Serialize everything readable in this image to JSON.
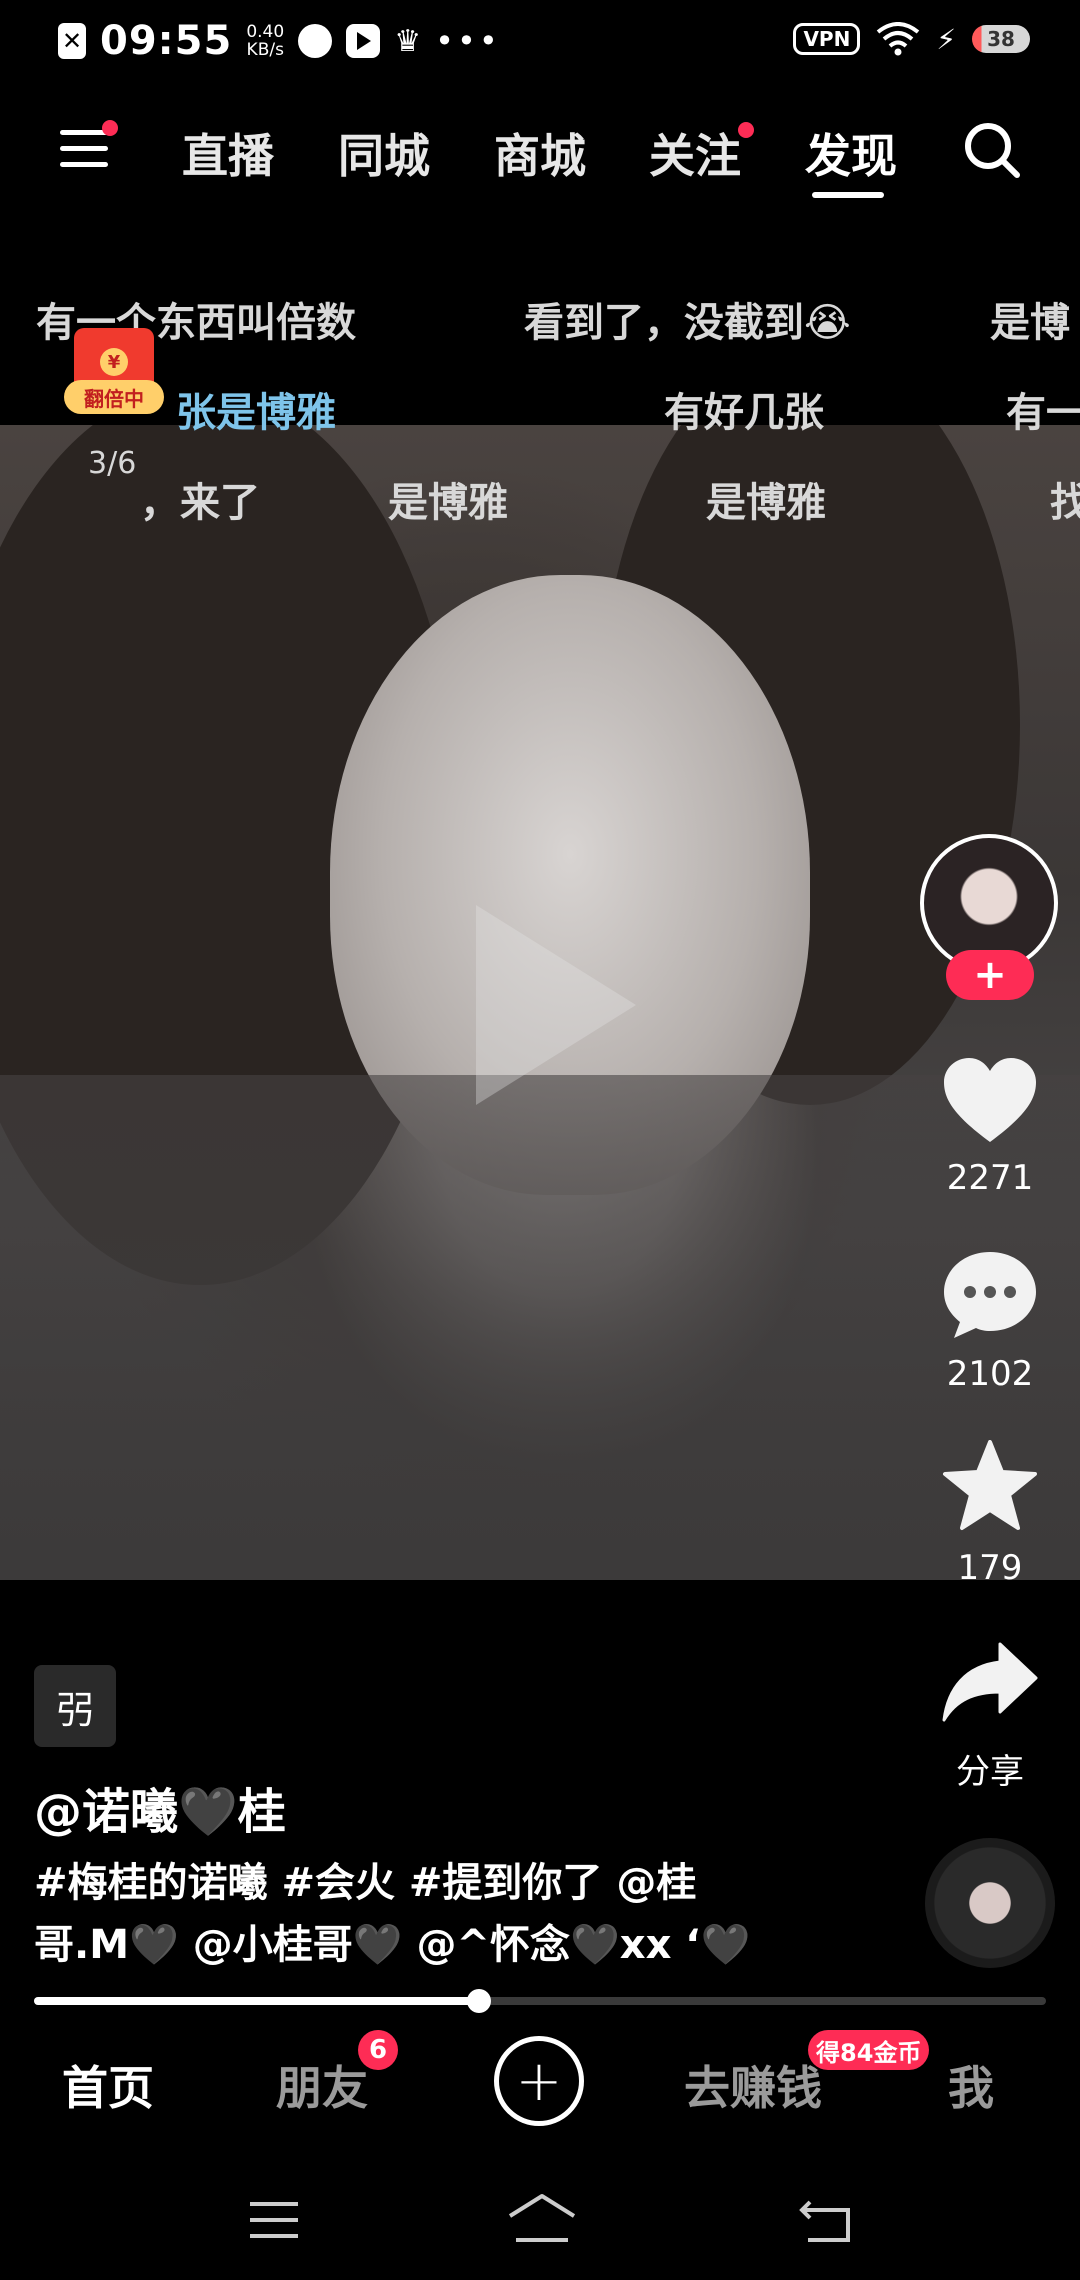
{
  "status_bar": {
    "time": "09:55",
    "speed_value": "0.40",
    "speed_unit": "KB/s",
    "vpn": "VPN",
    "battery": "38"
  },
  "top_nav": {
    "tabs": [
      "直播",
      "同城",
      "商城",
      "关注",
      "发现"
    ],
    "active_tab": "发现"
  },
  "danmaku": {
    "row1": [
      "有一个东西叫倍数",
      "看到了，没截到😭",
      "是博"
    ],
    "row2": [
      "张是博雅",
      "有好几张",
      "有一"
    ],
    "row3": [
      "，来了",
      "是博雅",
      "是博雅",
      "找"
    ]
  },
  "red_envelope": {
    "badge": "翻倍中",
    "count": "3/6"
  },
  "actions": {
    "follow": "+",
    "likes": "2271",
    "comments": "2102",
    "favorites": "179",
    "share": "分享"
  },
  "video_info": {
    "tag_glyph": "弜",
    "author": "@诺曦🖤桂",
    "desc_line1": "#梅桂的诺曦 #会火 #提到你了 @桂",
    "desc_line2": "哥.M🖤 @小桂哥🖤 @^怀念🖤xx ‘🖤"
  },
  "progress": {
    "fraction": 0.44
  },
  "bottom_nav": {
    "home": "首页",
    "friends": "朋友",
    "friends_badge": "6",
    "plus": "+",
    "earn": "去赚钱",
    "earn_badge": "得84金币",
    "me": "我"
  },
  "colors": {
    "accent": "#fe2c55"
  }
}
